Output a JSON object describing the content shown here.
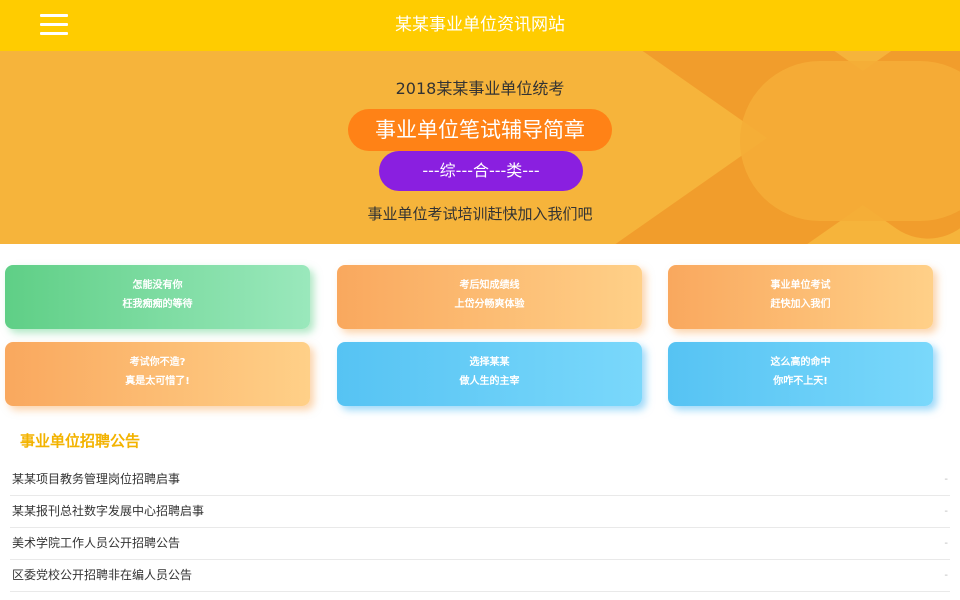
{
  "header": {
    "title": "某某事业单位资讯网站",
    "menu_icon": "hamburger-icon"
  },
  "banner": {
    "subtitle": "2018某某事业单位统考",
    "main_pill": "事业单位笔试辅导简章",
    "category_pill": "---综---合---类---",
    "tagline": "事业单位考试培训赶快加入我们吧"
  },
  "cards": [
    {
      "line1": "怎能没有你",
      "line2": "枉我痴痴的等待"
    },
    {
      "line1": "考后知成绩线",
      "line2": "上岱分畅爽体验"
    },
    {
      "line1": "事业单位考试",
      "line2": "赶快加入我们"
    },
    {
      "line1": "考试你不造?",
      "line2": "真是太可惜了!"
    },
    {
      "line1": "选择某某",
      "line2": "做人生的主宰"
    },
    {
      "line1": "这么高的命中",
      "line2": "你咋不上天!"
    }
  ],
  "notices": {
    "heading": "事业单位招聘公告",
    "items": [
      "某某项目教务管理岗位招聘启事",
      "某某报刊总社数字发展中心招聘启事",
      "美术学院工作人员公开招聘公告",
      "区委党校公开招聘非在编人员公告"
    ],
    "marker": "-"
  },
  "colors": {
    "topbar": "#ffcc00",
    "banner": "#f6b43b",
    "pill_orange": "#ff8216",
    "pill_purple": "#8a1fe0",
    "heading": "#f3b300"
  }
}
